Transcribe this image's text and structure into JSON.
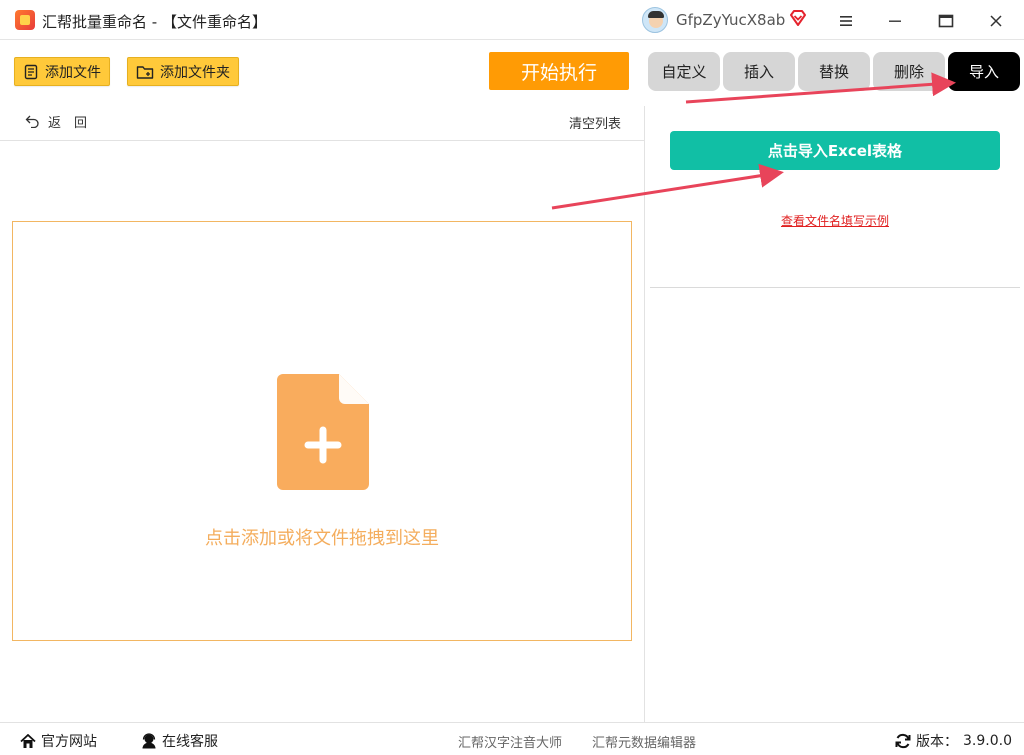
{
  "app": {
    "title": "汇帮批量重命名 - 【文件重命名】",
    "username": "GfpZyYucX8ab"
  },
  "toolbar": {
    "add_file": "添加文件",
    "add_folder": "添加文件夹",
    "start": "开始执行"
  },
  "tabs": [
    {
      "label": "自定义",
      "active": false
    },
    {
      "label": "插入",
      "active": false
    },
    {
      "label": "替换",
      "active": false
    },
    {
      "label": "删除",
      "active": false
    },
    {
      "label": "导入",
      "active": true
    }
  ],
  "list": {
    "back": "返　回",
    "clear": "清空列表",
    "drop_text": "点击添加或将文件拖拽到这里"
  },
  "import_panel": {
    "button": "点击导入Excel表格",
    "example_link": "查看文件名填写示例"
  },
  "footer": {
    "website": "官方网站",
    "service": "在线客服",
    "link1": "汇帮汉字注音大师",
    "link2": "汇帮元数据编辑器",
    "version_label": "版本：",
    "version": "3.9.0.0"
  },
  "colors": {
    "accent_orange": "#ff9b05",
    "button_yellow": "#ffc93a",
    "import_teal": "#11bfa5",
    "drop_icon": "#f9ac5d",
    "arrow_red": "#e8445a"
  }
}
